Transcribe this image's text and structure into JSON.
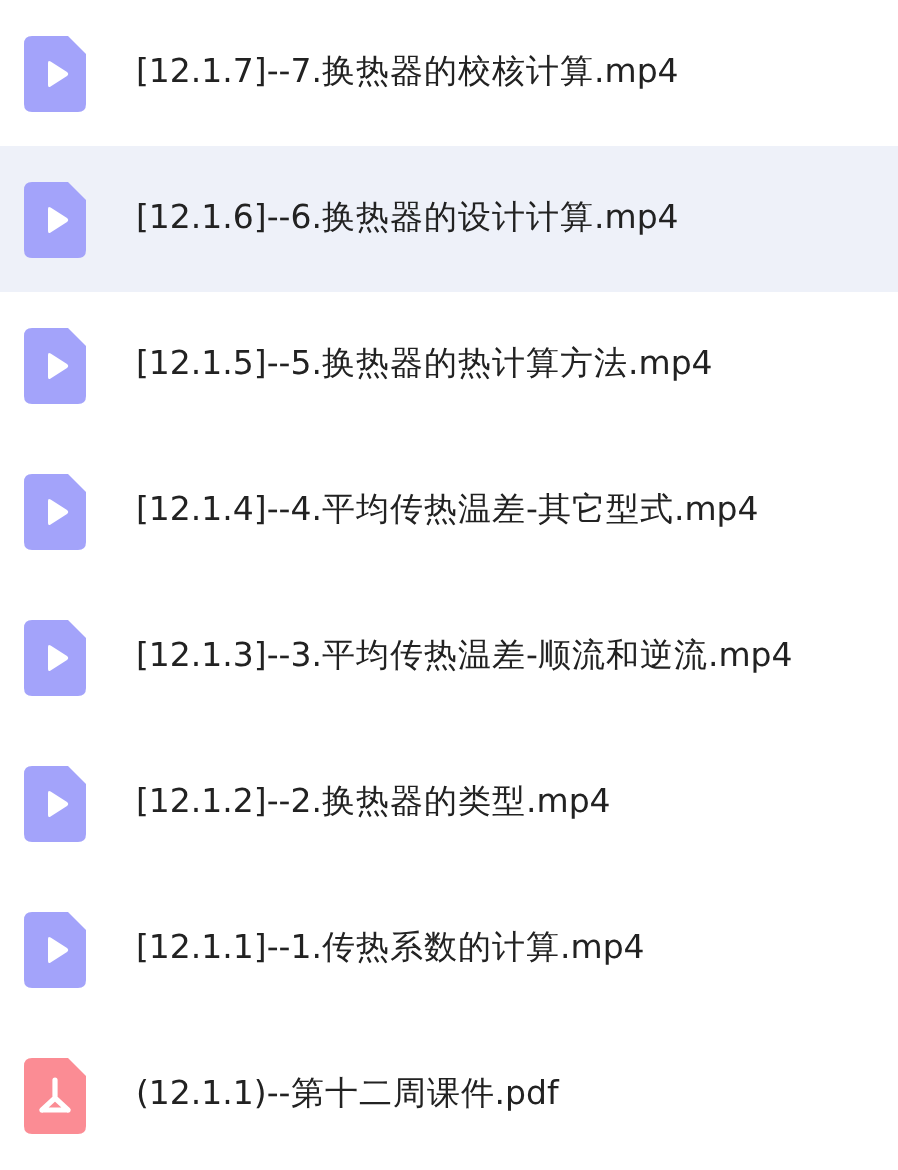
{
  "files": [
    {
      "name": "[12.1.7]--7.换热器的校核计算.mp4",
      "kind": "video",
      "selected": false
    },
    {
      "name": "[12.1.6]--6.换热器的设计计算.mp4",
      "kind": "video",
      "selected": true
    },
    {
      "name": "[12.1.5]--5.换热器的热计算方法.mp4",
      "kind": "video",
      "selected": false
    },
    {
      "name": "[12.1.4]--4.平均传热温差-其它型式.mp4",
      "kind": "video",
      "selected": false
    },
    {
      "name": "[12.1.3]--3.平均传热温差-顺流和逆流.mp4",
      "kind": "video",
      "selected": false
    },
    {
      "name": "[12.1.2]--2.换热器的类型.mp4",
      "kind": "video",
      "selected": false
    },
    {
      "name": "[12.1.1]--1.传热系数的计算.mp4",
      "kind": "video",
      "selected": false
    },
    {
      "name": "(12.1.1)--第十二周课件.pdf",
      "kind": "pdf",
      "selected": false
    }
  ]
}
